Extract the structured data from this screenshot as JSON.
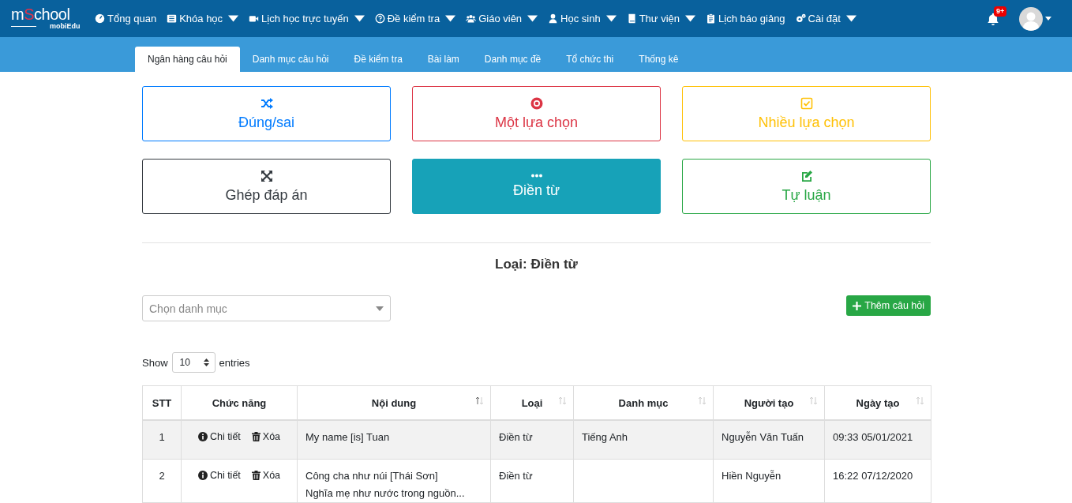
{
  "brand": {
    "name": "mSchool",
    "sub": "mobiEdu"
  },
  "nav": [
    {
      "label": "Tổng quan",
      "dropdown": false
    },
    {
      "label": "Khóa học",
      "dropdown": true
    },
    {
      "label": "Lịch học trực tuyến",
      "dropdown": true
    },
    {
      "label": "Đề kiểm tra",
      "dropdown": true
    },
    {
      "label": "Giáo viên",
      "dropdown": true
    },
    {
      "label": "Học sinh",
      "dropdown": true
    },
    {
      "label": "Thư viện",
      "dropdown": true
    },
    {
      "label": "Lịch báo giảng",
      "dropdown": false
    },
    {
      "label": "Cài đặt",
      "dropdown": true
    }
  ],
  "notifications": {
    "badge": "9+"
  },
  "tabs": [
    {
      "label": "Ngân hàng câu hỏi",
      "selected": true
    },
    {
      "label": "Danh mục câu hỏi",
      "selected": false
    },
    {
      "label": "Đề kiểm tra",
      "selected": false
    },
    {
      "label": "Bài làm",
      "selected": false
    },
    {
      "label": "Danh mục đề",
      "selected": false
    },
    {
      "label": "Tổ chức thi",
      "selected": false
    },
    {
      "label": "Thống kê",
      "selected": false
    }
  ],
  "question_types": [
    {
      "label": "Đúng/sai",
      "kind": "shuffle",
      "color": "#007bff",
      "selected": false
    },
    {
      "label": "Một lựa chọn",
      "kind": "radio",
      "color": "#dc3545",
      "selected": false
    },
    {
      "label": "Nhiều lựa chọn",
      "kind": "checkbox",
      "color": "#ffc107",
      "selected": false
    },
    {
      "label": "Ghép đáp án",
      "kind": "arrows",
      "color": "#343a40",
      "selected": false
    },
    {
      "label": "Điền từ",
      "kind": "dots",
      "color": "#17a2b8",
      "selected": true
    },
    {
      "label": "Tự luận",
      "kind": "edit",
      "color": "#28a745",
      "selected": false
    }
  ],
  "heading": "Loại: Điền từ",
  "category_select": {
    "placeholder": "Chọn danh mục"
  },
  "add_button": "Thêm câu hỏi",
  "length_menu": {
    "before": "Show",
    "value": "10",
    "after": "entries"
  },
  "table": {
    "columns": [
      {
        "label": "STT",
        "sortable": false
      },
      {
        "label": "Chức năng",
        "sortable": false
      },
      {
        "label": "Nội dung",
        "sortable": true,
        "sorted": true
      },
      {
        "label": "Loại",
        "sortable": true,
        "sorted": false
      },
      {
        "label": "Danh mục",
        "sortable": true,
        "sorted": false
      },
      {
        "label": "Người tạo",
        "sortable": true,
        "sorted": false
      },
      {
        "label": "Ngày tạo",
        "sortable": true,
        "sorted": false
      }
    ],
    "rows": [
      {
        "stt": "1",
        "actions": [
          "Chi tiết",
          "Xóa"
        ],
        "content": [
          "My name [is] Tuan"
        ],
        "type": "Điền từ",
        "category": "Tiếng Anh",
        "creator": "Nguyễn Văn Tuấn",
        "created": "09:33 05/01/2021"
      },
      {
        "stt": "2",
        "actions": [
          "Chi tiết",
          "Xóa"
        ],
        "content": [
          "Công cha như núi [Thái Sơn]",
          "Nghĩa mẹ như nước trong nguồn..."
        ],
        "type": "Điền từ",
        "creator": "Hiền Nguyễn",
        "created": "16:22 07/12/2020"
      }
    ]
  }
}
